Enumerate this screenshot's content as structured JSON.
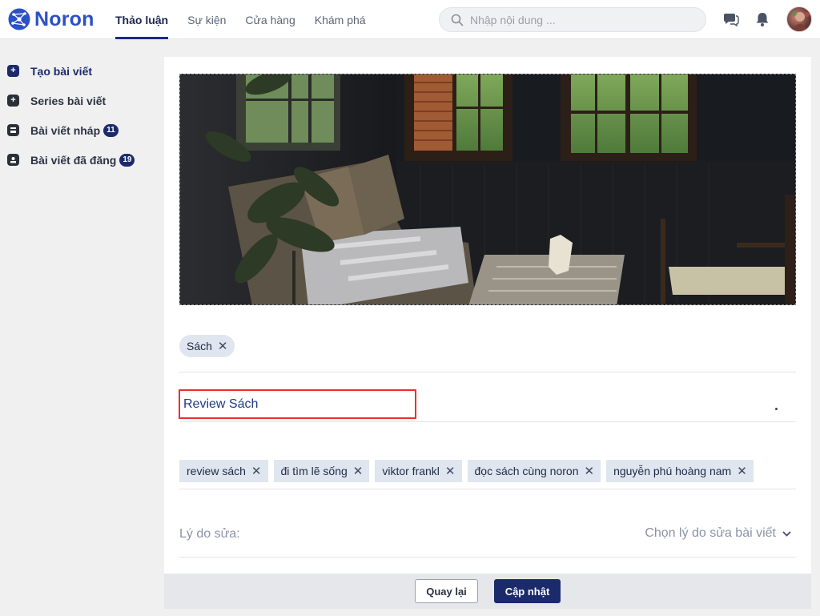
{
  "header": {
    "logo_text": "Noron",
    "nav": [
      {
        "label": "Thảo luận",
        "active": true
      },
      {
        "label": "Sự kiện",
        "active": false
      },
      {
        "label": "Cửa hàng",
        "active": false
      },
      {
        "label": "Khám phá",
        "active": false
      }
    ],
    "search_placeholder": "Nhập nội dung ...",
    "icons": [
      "chat-icon",
      "bell-icon",
      "avatar"
    ]
  },
  "sidebar": {
    "items": [
      {
        "label": "Tạo bài viết",
        "icon": "plus-icon",
        "active": true
      },
      {
        "label": "Series bài viết",
        "icon": "plus-icon",
        "active": false
      },
      {
        "label": "Bài viết nháp",
        "icon": "draft-icon",
        "badge": "11",
        "active": false
      },
      {
        "label": "Bài viết đã đăng",
        "icon": "published-icon",
        "badge": "19",
        "active": false
      }
    ]
  },
  "editor": {
    "category_chips": [
      {
        "label": "Sách"
      }
    ],
    "title": "Review Sách",
    "tags": [
      {
        "label": "review sách"
      },
      {
        "label": "đi tìm lẽ sống"
      },
      {
        "label": "viktor frankl"
      },
      {
        "label": "đọc sách cùng noron"
      },
      {
        "label": "nguyễn phú hoàng nam"
      }
    ],
    "reason_label": "Lý do sửa:",
    "reason_placeholder": "Chọn lý do sửa bài viết"
  },
  "footer": {
    "back_label": "Quay lại",
    "update_label": "Cập nhật"
  },
  "colors": {
    "brand": "#2b50c8",
    "primary": "#1b2a6b",
    "highlight_border": "#e8312f",
    "chip_bg": "#dfe6f0"
  }
}
